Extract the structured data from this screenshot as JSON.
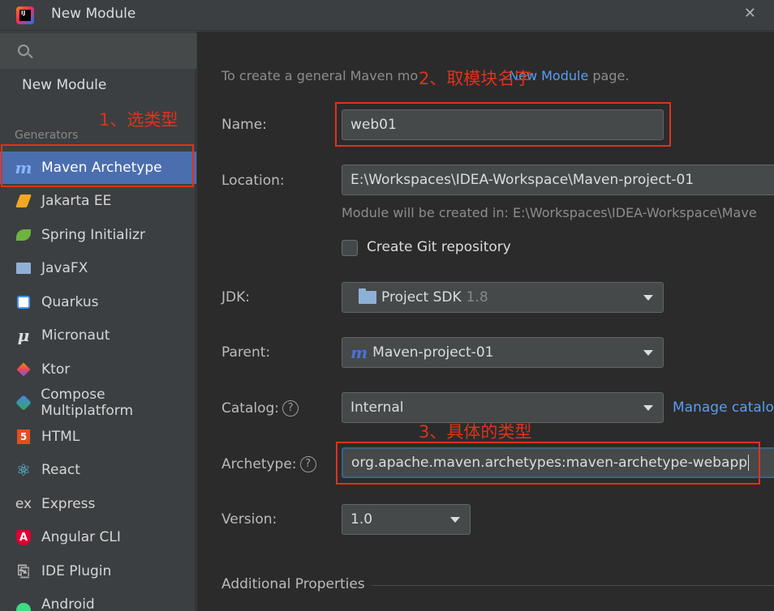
{
  "window": {
    "title": "New Module"
  },
  "sidebar": {
    "new_module": "New Module",
    "generators_label": "Generators",
    "items": [
      {
        "label": "Maven Archetype",
        "icon": "maven-icon"
      },
      {
        "label": "Jakarta EE",
        "icon": "jakarta-icon"
      },
      {
        "label": "Spring Initializr",
        "icon": "spring-icon"
      },
      {
        "label": "JavaFX",
        "icon": "javafx-icon"
      },
      {
        "label": "Quarkus",
        "icon": "quarkus-icon"
      },
      {
        "label": "Micronaut",
        "icon": "micronaut-icon"
      },
      {
        "label": "Ktor",
        "icon": "ktor-icon"
      },
      {
        "label": "Compose Multiplatform",
        "icon": "compose-icon"
      },
      {
        "label": "HTML",
        "icon": "html-icon"
      },
      {
        "label": "React",
        "icon": "react-icon"
      },
      {
        "label": "Express",
        "icon": "express-icon"
      },
      {
        "label": "Angular CLI",
        "icon": "angular-icon"
      },
      {
        "label": "IDE Plugin",
        "icon": "plugin-icon"
      },
      {
        "label": "Android",
        "icon": "android-icon"
      }
    ]
  },
  "form": {
    "hint_prefix": "To create a general Maven mo",
    "hint_link": "New Module",
    "hint_suffix": " page.",
    "name_label": "Name:",
    "name_value": "web01",
    "location_label": "Location:",
    "location_value": "E:\\Workspaces\\IDEA-Workspace\\Maven-project-01",
    "location_hint": "Module will be created in: E:\\Workspaces\\IDEA-Workspace\\Mave",
    "git_label": "Create Git repository",
    "jdk_label": "JDK:",
    "jdk_value": "Project SDK",
    "jdk_version": "1.8",
    "parent_label": "Parent:",
    "parent_value": "Maven-project-01",
    "catalog_label": "Catalog:",
    "catalog_value": "Internal",
    "manage_catalogs": "Manage catalog",
    "archetype_label": "Archetype:",
    "archetype_value": "org.apache.maven.archetypes:maven-archetype-webapp",
    "version_label": "Version:",
    "version_value": "1.0",
    "additional_props": "Additional Properties",
    "help_glyph": "?"
  },
  "annotations": {
    "step1": "1、选类型",
    "step2": "2、取模块名字",
    "step3": "3、具体的类型"
  },
  "colors": {
    "annotation": "#e0311f",
    "selection": "#4b6eaf",
    "link": "#589df6"
  }
}
